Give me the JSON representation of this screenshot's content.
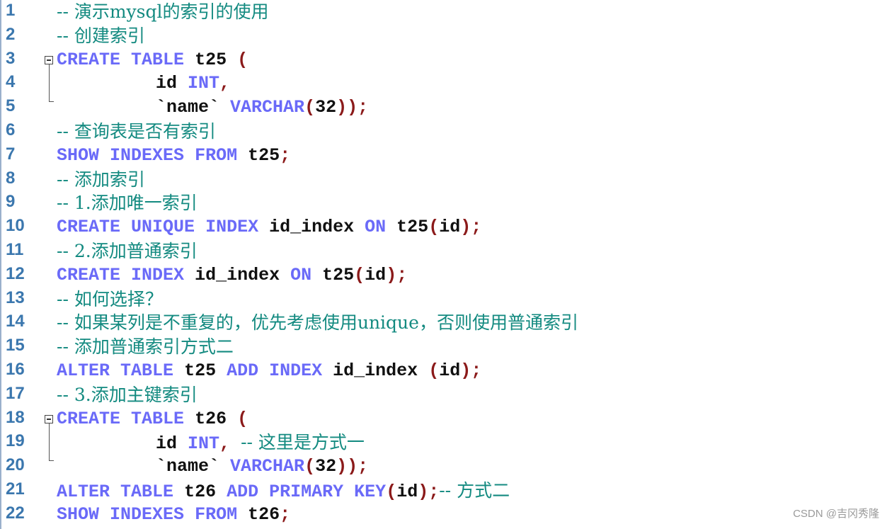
{
  "editor": {
    "lines": [
      {
        "n": "1",
        "tokens": [
          {
            "t": "cm",
            "v": "-- 演示mysql的索引的使用"
          }
        ]
      },
      {
        "n": "2",
        "tokens": [
          {
            "t": "cm",
            "v": "-- 创建索引"
          }
        ]
      },
      {
        "n": "3",
        "fold": "start",
        "tokens": [
          {
            "t": "kw",
            "v": "CREATE"
          },
          {
            "t": "sp",
            "v": " "
          },
          {
            "t": "kw",
            "v": "TABLE"
          },
          {
            "t": "sp",
            "v": " "
          },
          {
            "t": "id",
            "v": "t25"
          },
          {
            "t": "sp",
            "v": " "
          },
          {
            "t": "punc",
            "v": "("
          }
        ]
      },
      {
        "n": "4",
        "indent": true,
        "tokens": [
          {
            "t": "id",
            "v": "id"
          },
          {
            "t": "sp",
            "v": " "
          },
          {
            "t": "kw",
            "v": "INT"
          },
          {
            "t": "punc",
            "v": ","
          }
        ]
      },
      {
        "n": "5",
        "indent": true,
        "fold": "end",
        "tokens": [
          {
            "t": "id",
            "v": "`name`"
          },
          {
            "t": "sp",
            "v": " "
          },
          {
            "t": "kw",
            "v": "VARCHAR"
          },
          {
            "t": "punc",
            "v": "("
          },
          {
            "t": "id",
            "v": "32"
          },
          {
            "t": "punc",
            "v": "));"
          }
        ]
      },
      {
        "n": "6",
        "tokens": [
          {
            "t": "cm",
            "v": "-- 查询表是否有索引"
          }
        ]
      },
      {
        "n": "7",
        "tokens": [
          {
            "t": "kw",
            "v": "SHOW"
          },
          {
            "t": "sp",
            "v": " "
          },
          {
            "t": "kw",
            "v": "INDEXES"
          },
          {
            "t": "sp",
            "v": " "
          },
          {
            "t": "kw",
            "v": "FROM"
          },
          {
            "t": "sp",
            "v": " "
          },
          {
            "t": "id",
            "v": "t25"
          },
          {
            "t": "punc",
            "v": ";"
          }
        ]
      },
      {
        "n": "8",
        "tokens": [
          {
            "t": "cm",
            "v": "-- 添加索引"
          }
        ]
      },
      {
        "n": "9",
        "tokens": [
          {
            "t": "cm",
            "v": "-- 1.添加唯一索引"
          }
        ]
      },
      {
        "n": "10",
        "tokens": [
          {
            "t": "kw",
            "v": "CREATE"
          },
          {
            "t": "sp",
            "v": " "
          },
          {
            "t": "kw",
            "v": "UNIQUE"
          },
          {
            "t": "sp",
            "v": " "
          },
          {
            "t": "kw",
            "v": "INDEX"
          },
          {
            "t": "sp",
            "v": " "
          },
          {
            "t": "id",
            "v": "id_index"
          },
          {
            "t": "sp",
            "v": " "
          },
          {
            "t": "kw",
            "v": "ON"
          },
          {
            "t": "sp",
            "v": " "
          },
          {
            "t": "id",
            "v": "t25"
          },
          {
            "t": "punc",
            "v": "("
          },
          {
            "t": "id",
            "v": "id"
          },
          {
            "t": "punc",
            "v": ");"
          }
        ]
      },
      {
        "n": "11",
        "tokens": [
          {
            "t": "cm",
            "v": "-- 2.添加普通索引"
          }
        ]
      },
      {
        "n": "12",
        "tokens": [
          {
            "t": "kw",
            "v": "CREATE"
          },
          {
            "t": "sp",
            "v": " "
          },
          {
            "t": "kw",
            "v": "INDEX"
          },
          {
            "t": "sp",
            "v": " "
          },
          {
            "t": "id",
            "v": "id_index"
          },
          {
            "t": "sp",
            "v": " "
          },
          {
            "t": "kw",
            "v": "ON"
          },
          {
            "t": "sp",
            "v": " "
          },
          {
            "t": "id",
            "v": "t25"
          },
          {
            "t": "punc",
            "v": "("
          },
          {
            "t": "id",
            "v": "id"
          },
          {
            "t": "punc",
            "v": ");"
          }
        ]
      },
      {
        "n": "13",
        "tokens": [
          {
            "t": "cm",
            "v": "-- 如何选择？"
          }
        ]
      },
      {
        "n": "14",
        "tokens": [
          {
            "t": "cm",
            "v": "-- 如果某列是不重复的，优先考虑使用unique，否则使用普通索引"
          }
        ]
      },
      {
        "n": "15",
        "tokens": [
          {
            "t": "cm",
            "v": "-- 添加普通索引方式二"
          }
        ]
      },
      {
        "n": "16",
        "tokens": [
          {
            "t": "kw",
            "v": "ALTER"
          },
          {
            "t": "sp",
            "v": " "
          },
          {
            "t": "kw",
            "v": "TABLE"
          },
          {
            "t": "sp",
            "v": " "
          },
          {
            "t": "id",
            "v": "t25"
          },
          {
            "t": "sp",
            "v": " "
          },
          {
            "t": "kw",
            "v": "ADD"
          },
          {
            "t": "sp",
            "v": " "
          },
          {
            "t": "kw",
            "v": "INDEX"
          },
          {
            "t": "sp",
            "v": " "
          },
          {
            "t": "id",
            "v": "id_index"
          },
          {
            "t": "sp",
            "v": " "
          },
          {
            "t": "punc",
            "v": "("
          },
          {
            "t": "id",
            "v": "id"
          },
          {
            "t": "punc",
            "v": ");"
          }
        ]
      },
      {
        "n": "17",
        "tokens": [
          {
            "t": "cm",
            "v": "-- 3.添加主键索引"
          }
        ]
      },
      {
        "n": "18",
        "fold": "start",
        "tokens": [
          {
            "t": "kw",
            "v": "CREATE"
          },
          {
            "t": "sp",
            "v": " "
          },
          {
            "t": "kw",
            "v": "TABLE"
          },
          {
            "t": "sp",
            "v": " "
          },
          {
            "t": "id",
            "v": "t26"
          },
          {
            "t": "sp",
            "v": " "
          },
          {
            "t": "punc",
            "v": "("
          }
        ]
      },
      {
        "n": "19",
        "indent": true,
        "tokens": [
          {
            "t": "id",
            "v": "id"
          },
          {
            "t": "sp",
            "v": " "
          },
          {
            "t": "kw",
            "v": "INT"
          },
          {
            "t": "punc",
            "v": ","
          },
          {
            "t": "sp",
            "v": " "
          },
          {
            "t": "cm",
            "v": "-- 这里是方式一"
          }
        ]
      },
      {
        "n": "20",
        "indent": true,
        "fold": "end",
        "tokens": [
          {
            "t": "id",
            "v": "`name`"
          },
          {
            "t": "sp",
            "v": " "
          },
          {
            "t": "kw",
            "v": "VARCHAR"
          },
          {
            "t": "punc",
            "v": "("
          },
          {
            "t": "id",
            "v": "32"
          },
          {
            "t": "punc",
            "v": "));"
          }
        ]
      },
      {
        "n": "21",
        "tokens": [
          {
            "t": "kw",
            "v": "ALTER"
          },
          {
            "t": "sp",
            "v": " "
          },
          {
            "t": "kw",
            "v": "TABLE"
          },
          {
            "t": "sp",
            "v": " "
          },
          {
            "t": "id",
            "v": "t26"
          },
          {
            "t": "sp",
            "v": " "
          },
          {
            "t": "kw",
            "v": "ADD"
          },
          {
            "t": "sp",
            "v": " "
          },
          {
            "t": "kw",
            "v": "PRIMARY"
          },
          {
            "t": "sp",
            "v": " "
          },
          {
            "t": "kw",
            "v": "KEY"
          },
          {
            "t": "punc",
            "v": "("
          },
          {
            "t": "id",
            "v": "id"
          },
          {
            "t": "punc",
            "v": ");"
          },
          {
            "t": "cm",
            "v": "-- 方式二"
          }
        ]
      },
      {
        "n": "22",
        "tokens": [
          {
            "t": "kw",
            "v": "SHOW"
          },
          {
            "t": "sp",
            "v": " "
          },
          {
            "t": "kw",
            "v": "INDEXES"
          },
          {
            "t": "sp",
            "v": " "
          },
          {
            "t": "kw",
            "v": "FROM"
          },
          {
            "t": "sp",
            "v": " "
          },
          {
            "t": "id",
            "v": "t26"
          },
          {
            "t": "punc",
            "v": ";"
          }
        ]
      }
    ]
  },
  "colors": {
    "keyword": "#6a6af8",
    "identifier": "#111111",
    "punctuation": "#8b1a1a",
    "comment": "#138a80",
    "line_number": "#3b77ae"
  },
  "watermark": "CSDN @吉冈秀隆"
}
